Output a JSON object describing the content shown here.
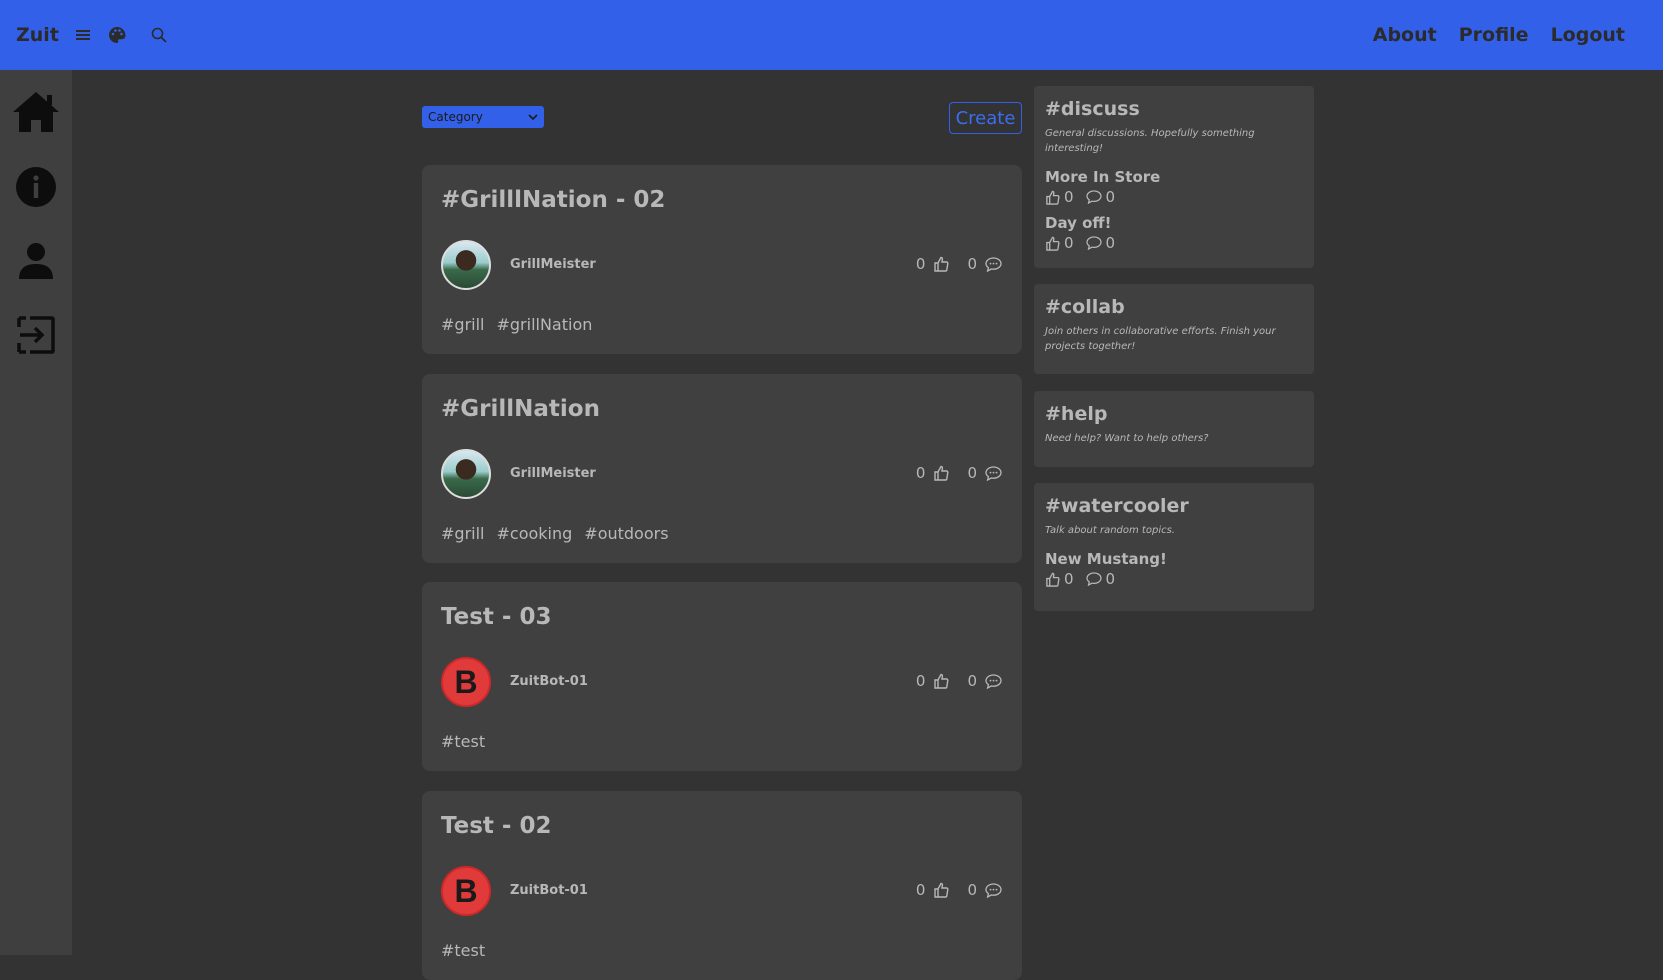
{
  "navbar": {
    "brand": "Zuit",
    "links": {
      "about": "About",
      "profile": "Profile",
      "logout": "Logout"
    }
  },
  "sidebar": {
    "items": [
      {
        "icon": "home-icon"
      },
      {
        "icon": "info-icon"
      },
      {
        "icon": "user-icon"
      },
      {
        "icon": "logout-icon"
      }
    ]
  },
  "feed": {
    "category_label": "Category",
    "create_label": "Create",
    "posts": [
      {
        "title": "#GrilllNation - 02",
        "author": "GrillMeister",
        "likes": "0",
        "comments": "0",
        "tags": [
          "#grill",
          "#grillNation"
        ]
      },
      {
        "title": "#GrillNation",
        "author": "GrillMeister",
        "likes": "0",
        "comments": "0",
        "tags": [
          "#grill",
          "#cooking",
          "#outdoors"
        ]
      },
      {
        "title": "Test - 03",
        "author": "ZuitBot-01",
        "avatar_letter": "B",
        "likes": "0",
        "comments": "0",
        "tags": [
          "#test"
        ]
      },
      {
        "title": "Test - 02",
        "author": "ZuitBot-01",
        "avatar_letter": "B",
        "likes": "0",
        "comments": "0",
        "tags": [
          "#test"
        ]
      }
    ]
  },
  "channels": [
    {
      "name": "#discuss",
      "description": "General discussions. Hopefully something interesting!",
      "threads": [
        {
          "title": "More In Store",
          "likes": "0",
          "comments": "0"
        },
        {
          "title": "Day off!",
          "likes": "0",
          "comments": "0"
        }
      ]
    },
    {
      "name": "#collab",
      "description": "Join others in collaborative efforts. Finish your projects together!",
      "threads": []
    },
    {
      "name": "#help",
      "description": "Need help? Want to help others?",
      "threads": []
    },
    {
      "name": "#watercooler",
      "description": "Talk about random topics.",
      "threads": [
        {
          "title": "New Mustang!",
          "likes": "0",
          "comments": "0"
        }
      ]
    }
  ],
  "colors": {
    "navbar": "#3360e8",
    "background": "#333333",
    "card": "#404040",
    "bot_avatar": "#e03a3a"
  }
}
